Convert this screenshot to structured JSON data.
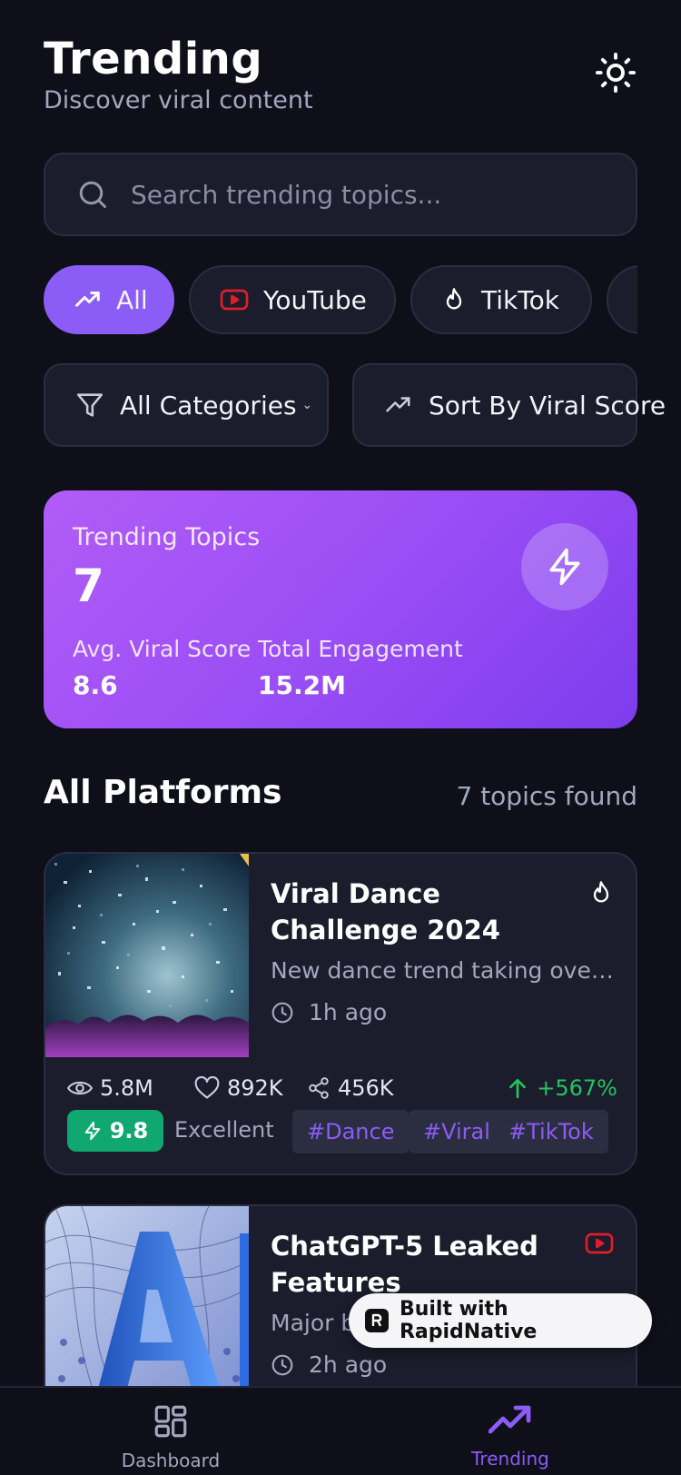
{
  "header": {
    "title": "Trending",
    "subtitle": "Discover viral content",
    "theme_icon": "sun-icon"
  },
  "search": {
    "placeholder": "Search trending topics..."
  },
  "platform_chips": [
    {
      "label": "All",
      "icon": "trending-up-icon",
      "active": true
    },
    {
      "label": "YouTube",
      "icon": "youtube-icon",
      "active": false
    },
    {
      "label": "TikTok",
      "icon": "flame-icon",
      "active": false
    }
  ],
  "filters": {
    "category_label": "All Categories",
    "sort_label": "Sort By Viral Score"
  },
  "stats": {
    "label": "Trending Topics",
    "count": "7",
    "avg_label": "Avg. Viral Score",
    "avg_value": "8.6",
    "engagement_label": "Total Engagement",
    "engagement_value": "15.2M"
  },
  "section": {
    "title": "All Platforms",
    "count_text": "7 topics found"
  },
  "cards": [
    {
      "title": "Viral Dance Challenge 2024",
      "platform_icon": "flame-icon",
      "description": "New dance trend taking over so...",
      "time": "1h ago",
      "views": "5.8M",
      "likes": "892K",
      "shares": "456K",
      "growth": "+567%",
      "score": "9.8",
      "score_label": "Excellent",
      "tags": [
        "#Dance",
        "#Viral",
        "#TikTok"
      ]
    },
    {
      "title": "ChatGPT-5 Leaked Features",
      "platform_icon": "youtube-icon",
      "description": "Major b",
      "time": "2h ago"
    }
  ],
  "badge": {
    "label": "Built with RapidNative"
  },
  "nav": {
    "items": [
      {
        "label": "Dashboard",
        "icon": "grid-icon",
        "active": false
      },
      {
        "label": "Trending",
        "icon": "trending-up-icon",
        "active": true
      }
    ]
  },
  "colors": {
    "background": "#0f0f1a",
    "surface": "#1b1c2c",
    "accent": "#8b5cf6",
    "growth": "#22c55e",
    "score": "#10a870",
    "youtube": "#e11d2a"
  }
}
